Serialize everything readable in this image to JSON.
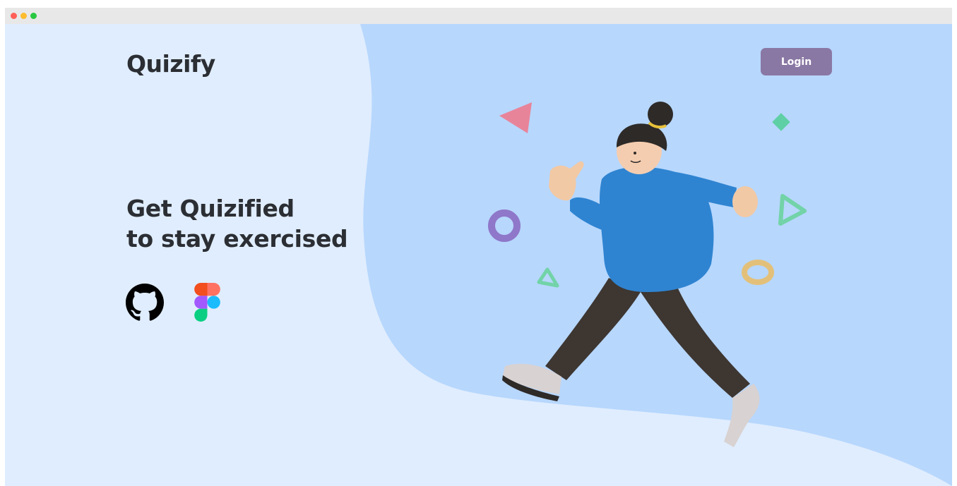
{
  "window": {
    "traffic_lights": [
      "#ff5f57",
      "#febc2e",
      "#28c840"
    ]
  },
  "colors": {
    "page_bg": "#e0edfe",
    "blob": "#b7d7fd",
    "text": "#2b2e33",
    "login_bg": "#8a78a4"
  },
  "header": {
    "brand": "Quizify",
    "login_label": "Login"
  },
  "hero": {
    "line1": "Get Quizified",
    "line2": "to stay exercised"
  },
  "links": [
    {
      "icon": "github-icon"
    },
    {
      "icon": "figma-icon"
    }
  ],
  "illustration": {
    "icon": "running-person-illustration"
  }
}
